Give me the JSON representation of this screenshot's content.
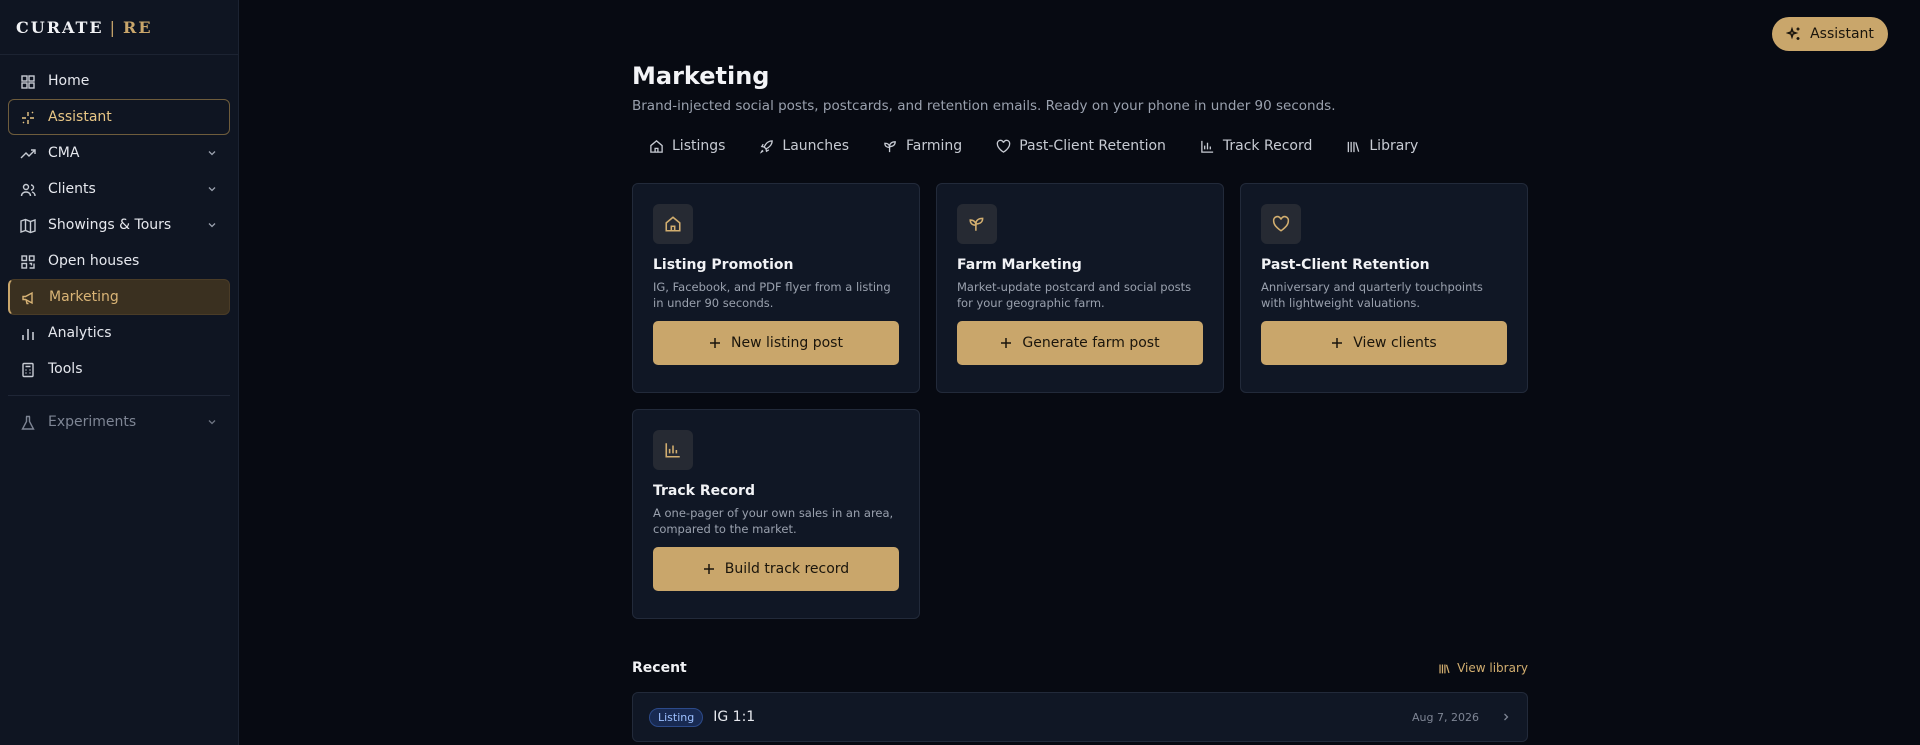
{
  "brand": {
    "left": "CURATE",
    "sep": "|",
    "right": "RE"
  },
  "sidebar": {
    "items": [
      {
        "label": "Home"
      },
      {
        "label": "Assistant"
      },
      {
        "label": "CMA"
      },
      {
        "label": "Clients"
      },
      {
        "label": "Showings & Tours"
      },
      {
        "label": "Open houses"
      },
      {
        "label": "Marketing"
      },
      {
        "label": "Analytics"
      },
      {
        "label": "Tools"
      },
      {
        "label": "Experiments"
      }
    ]
  },
  "header": {
    "assistant_label": "Assistant"
  },
  "page": {
    "title": "Marketing",
    "subtitle": "Brand-injected social posts, postcards, and retention emails. Ready on your phone in under 90 seconds."
  },
  "tabs": [
    {
      "label": "Listings"
    },
    {
      "label": "Launches"
    },
    {
      "label": "Farming"
    },
    {
      "label": "Past-Client Retention"
    },
    {
      "label": "Track Record"
    },
    {
      "label": "Library"
    }
  ],
  "cards": [
    {
      "title": "Listing Promotion",
      "desc": "IG, Facebook, and PDF flyer from a listing in under 90 seconds.",
      "button": "New listing post"
    },
    {
      "title": "Farm Marketing",
      "desc": "Market-update postcard and social posts for your geographic farm.",
      "button": "Generate farm post"
    },
    {
      "title": "Past-Client Retention",
      "desc": "Anniversary and quarterly touchpoints with lightweight valuations.",
      "button": "View clients"
    },
    {
      "title": "Track Record",
      "desc": "A one-pager of your own sales in an area, compared to the market.",
      "button": "Build track record"
    }
  ],
  "recent": {
    "title": "Recent",
    "view_library": "View library",
    "rows": [
      {
        "tag": "Listing",
        "title": "IG 1:1",
        "date": "Aug 7, 2026"
      }
    ]
  },
  "colors": {
    "accent": "#c9a66b",
    "background": "#070a12",
    "sidebar": "#0f1522",
    "card": "#101725"
  }
}
